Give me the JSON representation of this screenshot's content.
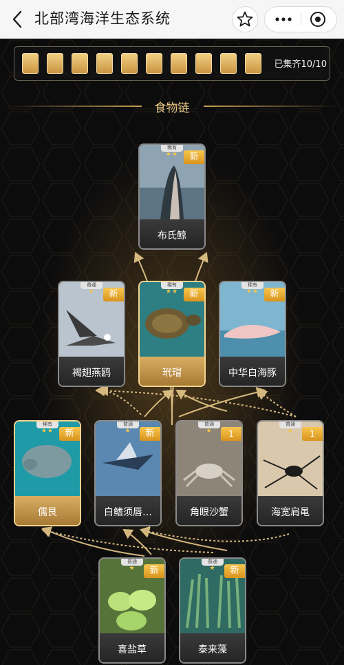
{
  "nav": {
    "title": "北部湾海洋生态系统",
    "back_icon": "chevron-left-icon",
    "actions": [
      "star-icon",
      "more-icon",
      "target-icon"
    ]
  },
  "collection": {
    "slots": 10,
    "collected": 10,
    "count_text": "已集齐10/10"
  },
  "section": {
    "title": "食物链"
  },
  "colors": {
    "gold": "#e9c884",
    "badge": "#f0b437",
    "accent_border": "#f3d38f"
  },
  "cards": [
    {
      "id": "bryde-whale",
      "name": "布氏鲸",
      "rarity": "稀有",
      "stars": "★★",
      "badge": "新",
      "selected": false,
      "photo": "whale"
    },
    {
      "id": "tern",
      "name": "褐翅燕鸥",
      "rarity": "普通",
      "stars": "★",
      "badge": "新",
      "selected": false,
      "photo": "tern"
    },
    {
      "id": "hawksbill",
      "name": "玳瑁",
      "rarity": "稀有",
      "stars": "★★",
      "badge": "新",
      "selected": true,
      "photo": "turtle"
    },
    {
      "id": "dolphin",
      "name": "中华白海豚",
      "rarity": "稀有",
      "stars": "★★",
      "badge": "新",
      "selected": false,
      "photo": "dolphin"
    },
    {
      "id": "dugong",
      "name": "儒艮",
      "rarity": "稀有",
      "stars": "★★",
      "badge": "新",
      "selected": true,
      "photo": "dugong"
    },
    {
      "id": "flyingfish",
      "name": "白鳍须唇…",
      "rarity": "普通",
      "stars": "★",
      "badge": "新",
      "selected": false,
      "photo": "flyingfish"
    },
    {
      "id": "ghostcrab",
      "name": "角眼沙蟹",
      "rarity": "普通",
      "stars": "★",
      "badge": "1",
      "selected": false,
      "photo": "crab"
    },
    {
      "id": "seastrider",
      "name": "海宽肩黾",
      "rarity": "普通",
      "stars": "★",
      "badge": "1",
      "selected": false,
      "photo": "strider"
    },
    {
      "id": "halophila",
      "name": "喜盐草",
      "rarity": "普通",
      "stars": "★",
      "badge": "新",
      "selected": false,
      "photo": "grass"
    },
    {
      "id": "thalassia",
      "name": "泰来藻",
      "rarity": "普通",
      "stars": "★",
      "badge": "新",
      "selected": false,
      "photo": "seagrass"
    }
  ]
}
